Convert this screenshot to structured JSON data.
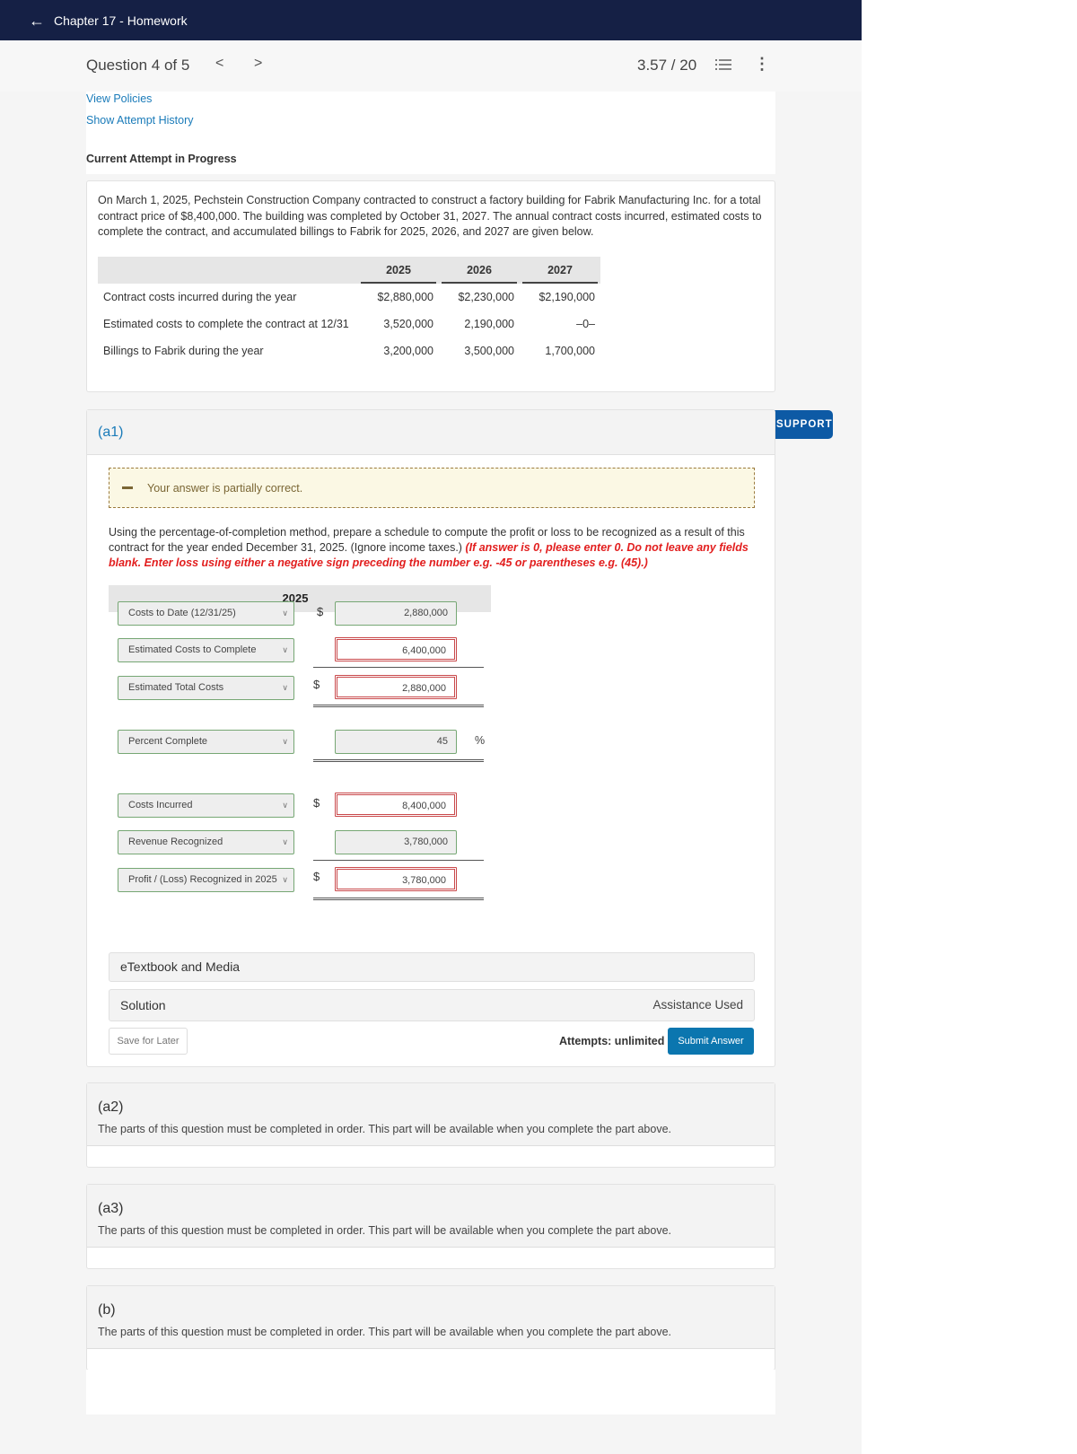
{
  "header": {
    "back_icon": "arrow-left-icon",
    "title": "Chapter 17 - Homework"
  },
  "question_bar": {
    "title": "Question 4 of 5",
    "prev_label": "<",
    "next_label": ">",
    "score": "3.57 / 20",
    "list_icon": "numbered-list-icon",
    "menu_icon": "more-vertical-icon"
  },
  "links": {
    "view_policies": "View Policies",
    "show_attempt_history": "Show Attempt History"
  },
  "attempt_status": "Current Attempt in Progress",
  "problem": {
    "text": "On March 1, 2025, Pechstein Construction Company contracted to construct a factory building for Fabrik Manufacturing Inc. for a total contract price of $8,400,000. The building was completed by October 31, 2027. The annual contract costs incurred, estimated costs to complete the contract, and accumulated billings to Fabrik for 2025, 2026, and 2027 are given below.",
    "table": {
      "columns": [
        "2025",
        "2026",
        "2027"
      ],
      "rows": [
        {
          "label": "Contract costs incurred during the year",
          "values": [
            "$2,880,000",
            "$2,230,000",
            "$2,190,000"
          ]
        },
        {
          "label": "Estimated costs to complete the contract at 12/31",
          "values": [
            "3,520,000",
            "2,190,000",
            "–0–"
          ]
        },
        {
          "label": "Billings to Fabrik during the year",
          "values": [
            "3,200,000",
            "3,500,000",
            "1,700,000"
          ]
        }
      ]
    }
  },
  "support_button": {
    "icon": "chat-icon",
    "label": "SUPPORT"
  },
  "part_a1": {
    "label": "(a1)",
    "feedback": "Your answer is partially correct.",
    "instructions": "Using the percentage-of-completion method, prepare a schedule to compute the profit or loss to be recognized as a result of this contract for the year ended December 31, 2025. (Ignore income taxes.)",
    "instructions_red": "(If answer is 0, please enter 0. Do not leave any fields blank. Enter loss using either a negative sign preceding the number e.g. -45 or parentheses e.g. (45).)",
    "schedule_header": "2025",
    "rows": [
      {
        "select": "Costs to Date (12/31/25)",
        "currency": "$",
        "value": "2,880,000",
        "status": "correct"
      },
      {
        "select": "Estimated Costs to Complete",
        "currency": "",
        "value": "6,400,000",
        "status": "incorrect"
      },
      {
        "select": "Estimated Total Costs",
        "currency": "$",
        "value": "2,880,000",
        "status": "incorrect"
      },
      {
        "select": "Percent Complete",
        "currency": "",
        "value": "45",
        "unit": "%",
        "status": "correct"
      },
      {
        "select": "Costs Incurred",
        "currency": "$",
        "value": "8,400,000",
        "status": "incorrect"
      },
      {
        "select": "Revenue Recognized",
        "currency": "",
        "value": "3,780,000",
        "status": "correct"
      },
      {
        "select": "Profit / (Loss) Recognized in 2025",
        "currency": "$",
        "value": "3,780,000",
        "status": "incorrect"
      }
    ],
    "etextbook_label": "eTextbook and Media",
    "solution_label": "Solution",
    "assistance_label": "Assistance Used",
    "save_label": "Save for Later",
    "attempts_label": "Attempts: unlimited",
    "submit_label": "Submit Answer"
  },
  "locked_parts": [
    {
      "label": "(a2)",
      "message": "The parts of this question must be completed in order. This part will be available when you complete the part above."
    },
    {
      "label": "(a3)",
      "message": "The parts of this question must be completed in order. This part will be available when you complete the part above."
    },
    {
      "label": "(b)",
      "message": "The parts of this question must be completed in order. This part will be available when you complete the part above."
    }
  ],
  "colors": {
    "header_bg": "#152045",
    "link": "#1a7bb9",
    "correct_border": "#76a774",
    "incorrect_border": "#c9494b",
    "submit_bg": "#0b76af",
    "support_bg": "#0d5aa5",
    "instruction_red": "#e21e1e"
  }
}
